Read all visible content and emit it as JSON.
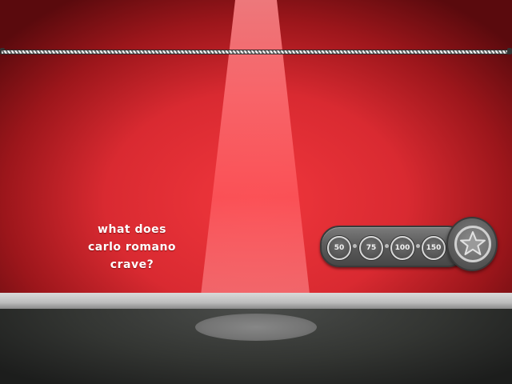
{
  "question": {
    "lines": [
      "what does",
      "carlo romano",
      "crave?"
    ]
  },
  "points": {
    "values": [
      "50",
      "75",
      "100",
      "150"
    ],
    "star_icon": "star-icon"
  },
  "colors": {
    "backdrop": "#d92a31",
    "spotlight": "#ff6b6e",
    "stage_floor": "#333532",
    "stage_edge": "#cfcfcf",
    "panel": "#5c5c5c",
    "chip_ring": "#d8d8d8",
    "text": "#ffffff"
  }
}
